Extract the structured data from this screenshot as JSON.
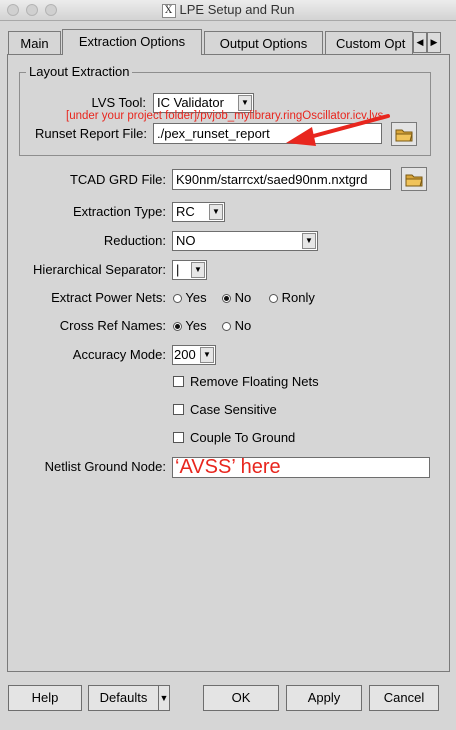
{
  "window": {
    "title": "LPE Setup and Run",
    "x_icon_glyph": "X"
  },
  "tabs": [
    {
      "label": "Main"
    },
    {
      "label": "Extraction Options"
    },
    {
      "label": "Output Options"
    },
    {
      "label": "Custom Opt"
    }
  ],
  "layout_extraction": {
    "group_title": "Layout Extraction",
    "lvs_tool_label": "LVS Tool:",
    "lvs_tool_value": "IC Validator",
    "runset_label": "Runset Report File:",
    "runset_value": "./pex_runset_report"
  },
  "form": {
    "tcad_label": "TCAD GRD File:",
    "tcad_value": "K90nm/starrcxt/saed90nm.nxtgrd",
    "extraction_type_label": "Extraction Type:",
    "extraction_type_value": "RC",
    "reduction_label": "Reduction:",
    "reduction_value": "NO",
    "hier_sep_label": "Hierarchical Separator:",
    "hier_sep_value": "|",
    "power_nets_label": "Extract Power Nets:",
    "power_nets_options": [
      "Yes",
      "No",
      "Ronly"
    ],
    "cross_ref_label": "Cross Ref Names:",
    "cross_ref_options": [
      "Yes",
      "No"
    ],
    "accuracy_label": "Accuracy Mode:",
    "accuracy_value": "200",
    "remove_floating_label": "Remove Floating Nets",
    "case_sensitive_label": "Case Sensitive",
    "couple_ground_label": "Couple To Ground",
    "netlist_ground_label": "Netlist Ground Node:",
    "netlist_ground_value": ""
  },
  "annotations": {
    "runset_hint": "[under your project folder]/pvjob_mylibrary.ringOscillator.icv.lvs",
    "ground_hint": "‘AVSS’ here",
    "color": "#e8261e"
  },
  "buttons": {
    "help": "Help",
    "defaults": "Defaults",
    "ok": "OK",
    "apply": "Apply",
    "cancel": "Cancel"
  }
}
